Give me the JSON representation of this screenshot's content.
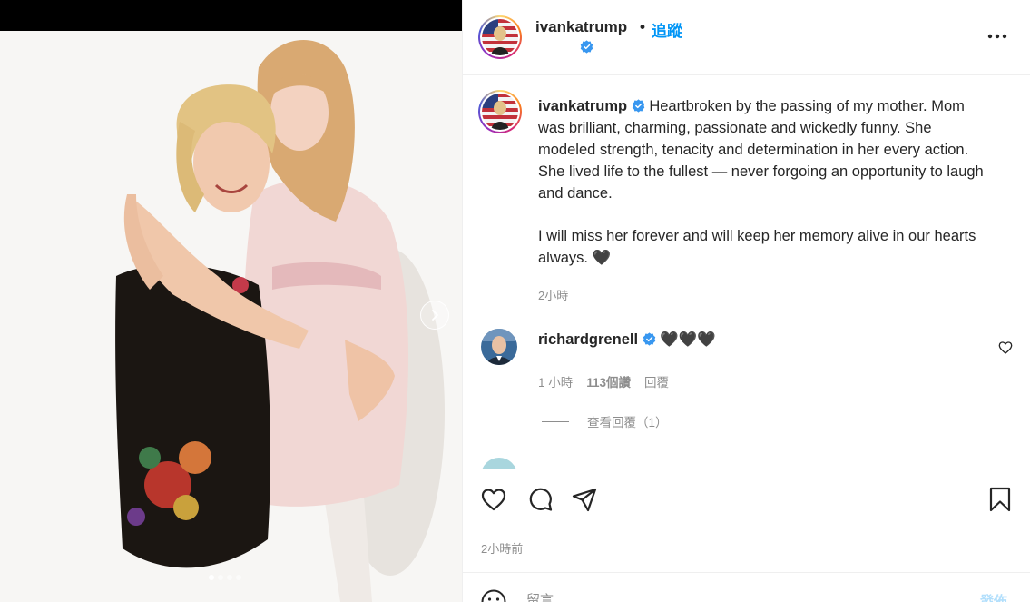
{
  "header": {
    "username": "ivankatrump",
    "separator": "•",
    "follow_label": "追蹤"
  },
  "caption": {
    "username": "ivankatrump",
    "paragraph1": "Heartbroken by the passing of my mother. Mom was brilliant, charming, passionate and wickedly funny. She modeled strength, tenacity and determination in her every action. She lived life to the fullest — never forgoing an opportunity to laugh and dance.",
    "paragraph2": "I will miss her forever and will keep her memory alive in our hearts always. 🖤",
    "time": "2小時"
  },
  "comment": {
    "username": "richardgrenell",
    "text": "🖤🖤🖤",
    "time": "1 小時",
    "likes": "113個讚",
    "reply_label": "回覆",
    "view_replies": "查看回覆（1）"
  },
  "actions": {
    "post_time": "2小時前"
  },
  "add_comment": {
    "placeholder": "留言......",
    "post_label": "發佈"
  },
  "carousel": {
    "total": 4,
    "active": 1
  },
  "colors": {
    "accent": "#0095f6",
    "verified": "#3897f0",
    "muted": "#8e8e8e",
    "post_disabled": "#b2dffc"
  },
  "icons": [
    "chevron-right-icon",
    "verified-badge-icon",
    "more-icon",
    "heart-icon",
    "comment-icon",
    "share-icon",
    "bookmark-icon",
    "emoji-icon"
  ]
}
